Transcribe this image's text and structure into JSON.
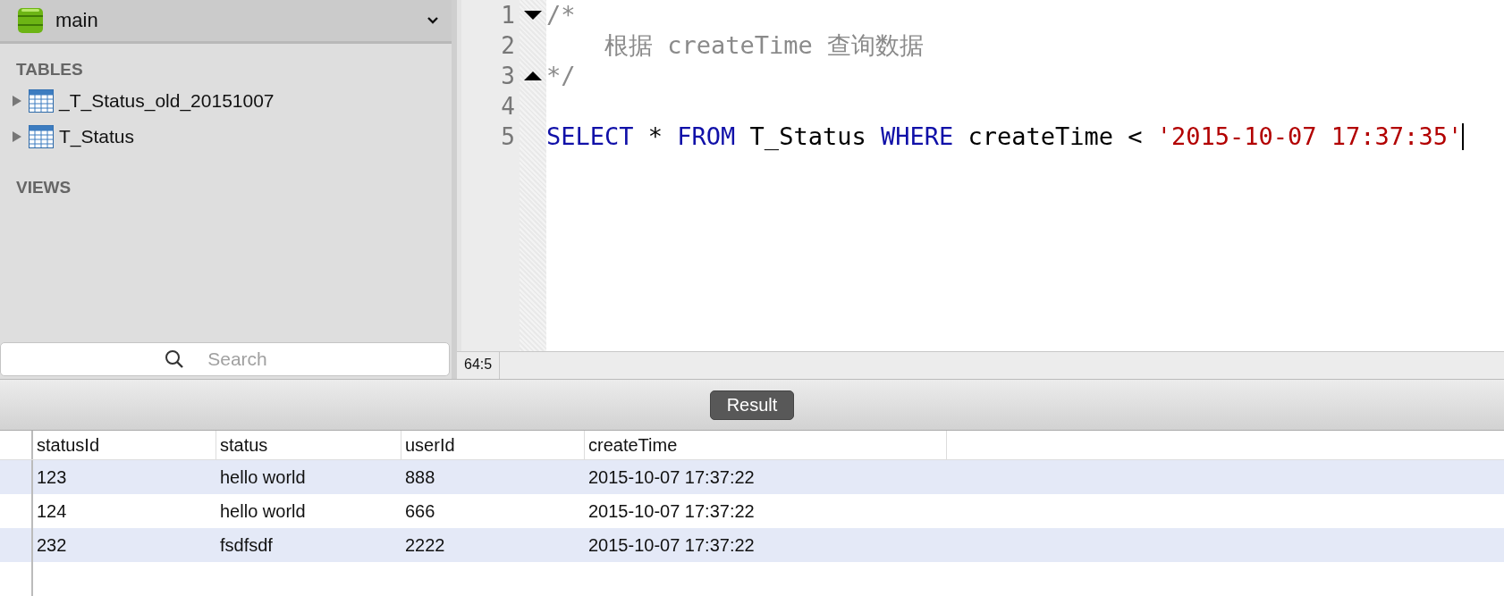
{
  "database_selector": {
    "value": "main"
  },
  "sidebar": {
    "sections": [
      {
        "title": "TABLES",
        "items": [
          {
            "label": "_T_Status_old_20151007",
            "expanded": false
          },
          {
            "label": "T_Status",
            "expanded": false
          }
        ]
      },
      {
        "title": "VIEWS"
      }
    ]
  },
  "search": {
    "placeholder": "Search"
  },
  "editor": {
    "lines": [
      {
        "number": "1",
        "fold_start": true,
        "fold_end": false,
        "tokens": [
          {
            "text": "/*",
            "kind": "comment"
          }
        ]
      },
      {
        "number": "2",
        "fold_start": false,
        "fold_end": false,
        "tokens": [
          {
            "text": "    根据 createTime 查询数据",
            "kind": "comment"
          }
        ]
      },
      {
        "number": "3",
        "fold_start": false,
        "fold_end": true,
        "tokens": [
          {
            "text": "*/",
            "kind": "comment"
          }
        ]
      },
      {
        "number": "4",
        "fold_start": false,
        "fold_end": false
      },
      {
        "number": "5",
        "fold_start": false,
        "fold_end": false,
        "tokens": [
          {
            "text": "SELECT",
            "kind": "keyword"
          },
          {
            "text": " * ",
            "kind": "plain"
          },
          {
            "text": "FROM",
            "kind": "keyword"
          },
          {
            "text": " T_Status ",
            "kind": "plain"
          },
          {
            "text": "WHERE",
            "kind": "keyword"
          },
          {
            "text": " createTime < ",
            "kind": "plain"
          },
          {
            "text": "'2015-10-07 17:37:35'",
            "kind": "string"
          }
        ]
      }
    ],
    "cursor_position": "64:5"
  },
  "result_button": {
    "label": "Result"
  },
  "table": {
    "columns": [
      "statusId",
      "status",
      "userId",
      "createTime"
    ],
    "rows": [
      [
        "123",
        "hello world",
        "888",
        "2015-10-07 17:37:22"
      ],
      [
        "124",
        "hello world",
        "666",
        "2015-10-07 17:37:22"
      ],
      [
        "232",
        "fsdfsdf",
        "2222",
        "2015-10-07 17:37:22"
      ]
    ]
  }
}
